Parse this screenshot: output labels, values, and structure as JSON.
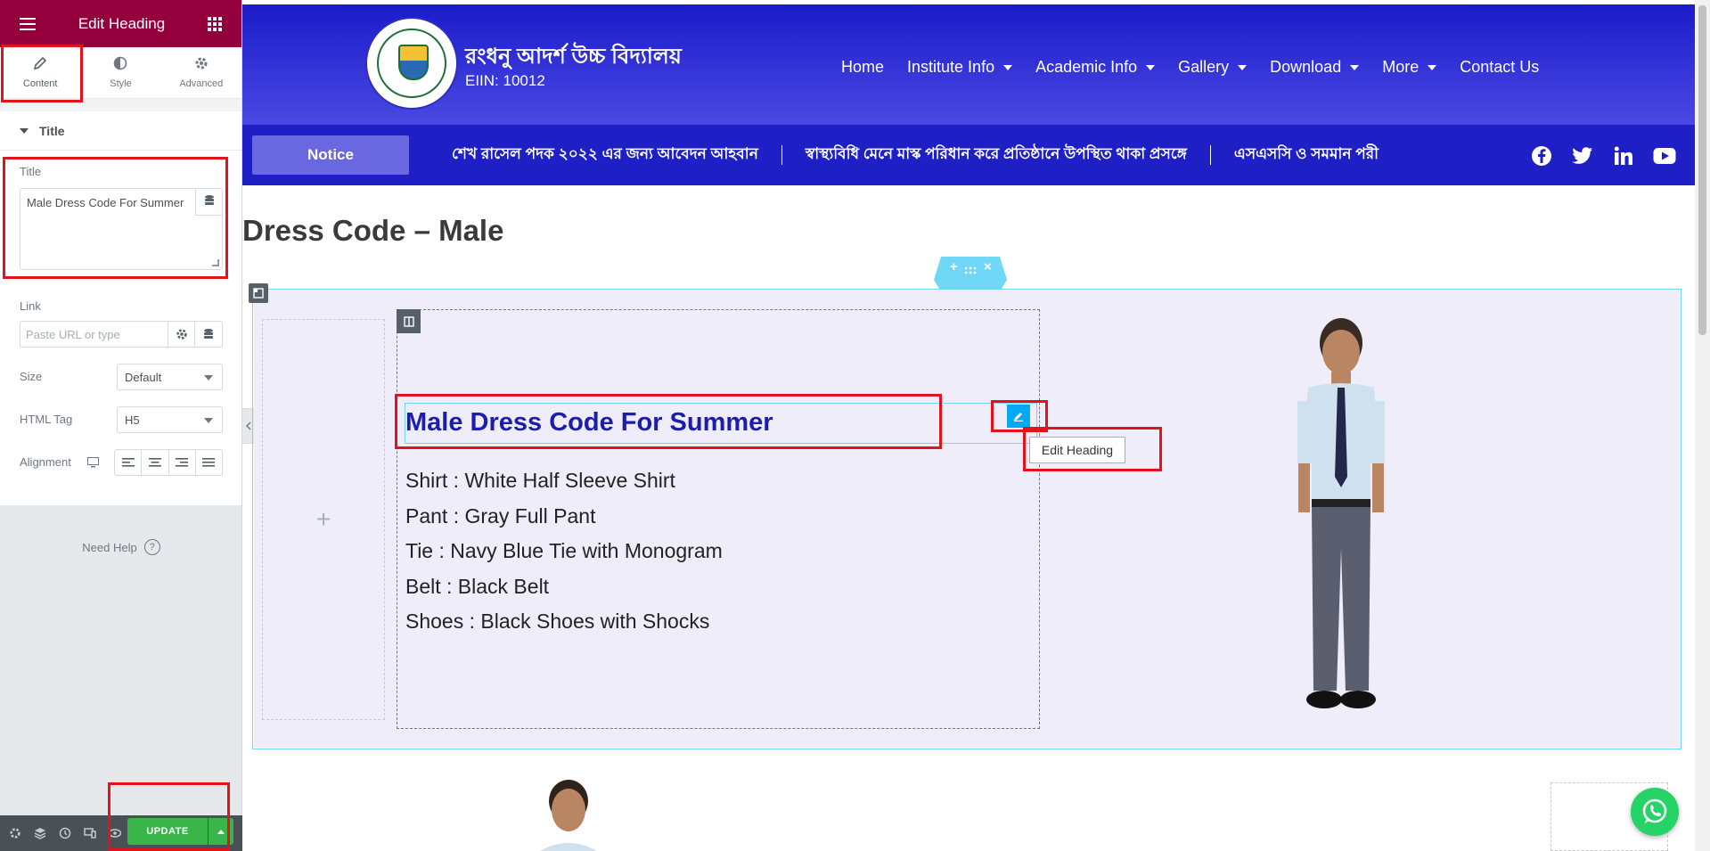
{
  "panel": {
    "header_title": "Edit Heading",
    "tabs": [
      {
        "label": "Content",
        "icon": "pencil-icon",
        "active": true
      },
      {
        "label": "Style",
        "icon": "half-circle-icon",
        "active": false
      },
      {
        "label": "Advanced",
        "icon": "gear-icon",
        "active": false
      }
    ],
    "section_title": "Title",
    "title_label": "Title",
    "title_value": "Male Dress Code For Summer",
    "link_label": "Link",
    "link_placeholder": "Paste URL or type",
    "size_label": "Size",
    "size_value": "Default",
    "html_tag_label": "HTML Tag",
    "html_tag_value": "H5",
    "alignment_label": "Alignment",
    "need_help": "Need Help",
    "update_label": "UPDATE"
  },
  "site": {
    "school_name": "রংধনু আদর্শ উচ্চ বিদ্যালয়",
    "eiin": "EIIN: 10012",
    "nav": [
      {
        "label": "Home",
        "dropdown": false
      },
      {
        "label": "Institute Info",
        "dropdown": true
      },
      {
        "label": "Academic Info",
        "dropdown": true
      },
      {
        "label": "Gallery",
        "dropdown": true
      },
      {
        "label": "Download",
        "dropdown": true
      },
      {
        "label": "More",
        "dropdown": true
      },
      {
        "label": "Contact Us",
        "dropdown": false
      }
    ],
    "notice_label": "Notice",
    "ticker": [
      "শেখ রাসেল পদক ২০২২ এর জন্য আবেদন আহবান",
      "স্বাস্থ্যবিধি মেনে মাস্ক পরিধান করে প্রতিষ্ঠানে উপস্থিত থাকা প্রসঙ্গে",
      "এসএসসি ও সমমান পরী"
    ],
    "social": [
      "facebook-icon",
      "twitter-icon",
      "linkedin-icon",
      "youtube-icon"
    ],
    "page_title": "Dress Code – Male"
  },
  "content": {
    "heading": "Male Dress Code For Summer",
    "tooltip": "Edit Heading",
    "items": [
      "Shirt : White Half Sleeve Shirt",
      "Pant : Gray Full Pant",
      "Tie : Navy Blue Tie with Monogram",
      "Belt : Black Belt",
      "Shoes : Black Shoes with Shocks"
    ]
  },
  "colors": {
    "panel_header": "#93003c",
    "site_header": "#1b1bc9",
    "heading": "#1d1dad",
    "update": "#39b54a",
    "annotation": "#e0141a"
  }
}
